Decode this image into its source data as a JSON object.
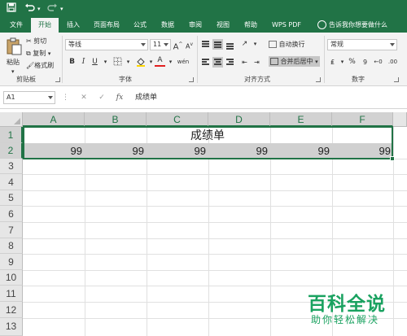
{
  "colors": {
    "accent": "#217346",
    "watermark": "#1aa260"
  },
  "tabs": [
    {
      "label": "文件",
      "active": false
    },
    {
      "label": "开始",
      "active": true
    },
    {
      "label": "插入",
      "active": false
    },
    {
      "label": "页面布局",
      "active": false
    },
    {
      "label": "公式",
      "active": false
    },
    {
      "label": "数据",
      "active": false
    },
    {
      "label": "审阅",
      "active": false
    },
    {
      "label": "视图",
      "active": false
    },
    {
      "label": "帮助",
      "active": false
    },
    {
      "label": "WPS PDF",
      "active": false
    }
  ],
  "tell_me": "告诉我你想要做什么",
  "clipboard": {
    "paste": "粘贴",
    "cut": "剪切",
    "copy": "复制",
    "format_painter": "格式刷",
    "group": "剪贴板"
  },
  "font": {
    "name": "等线",
    "size": "11",
    "group": "字体",
    "grow": "A",
    "shrink": "A",
    "bold": "B",
    "italic": "I",
    "underline": "U",
    "font_color": "A",
    "phonetic": "wén"
  },
  "alignment": {
    "wrap": "自动换行",
    "merge": "合并后居中",
    "group": "对齐方式"
  },
  "number": {
    "format": "常规",
    "percent": "%",
    "comma": "9",
    "group": "数字"
  },
  "formula_bar": {
    "name_box": "A1",
    "cancel": "✕",
    "enter": "✓",
    "fx": "fx",
    "content": "成绩单"
  },
  "columns": [
    "A",
    "B",
    "C",
    "D",
    "E",
    "F"
  ],
  "rows": [
    "1",
    "2",
    "3",
    "4",
    "5",
    "6",
    "7",
    "8",
    "9",
    "10",
    "11",
    "12",
    "13"
  ],
  "sheet": {
    "title": "成绩单",
    "row2": [
      "99",
      "99",
      "99",
      "99",
      "99",
      "99"
    ]
  },
  "watermark": {
    "title": "百科全说",
    "subtitle": "助你轻松解决"
  }
}
